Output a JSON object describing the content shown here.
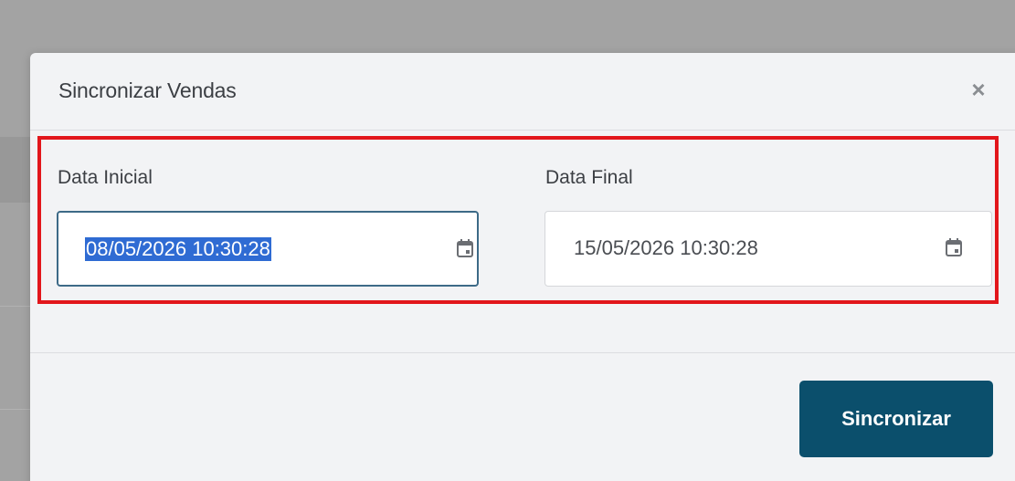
{
  "modal": {
    "title": "Sincronizar Vendas",
    "close_symbol": "×",
    "close_icon": "close-icon"
  },
  "form": {
    "start": {
      "label": "Data Inicial",
      "value": "08/05/2026 10:30:28",
      "icon": "calendar-icon",
      "state": "focused, text selected"
    },
    "end": {
      "label": "Data Final",
      "value": "15/05/2026 10:30:28",
      "icon": "calendar-icon"
    }
  },
  "footer": {
    "submit_label": "Sincronizar"
  },
  "colors": {
    "highlight_border": "#e2161b",
    "primary_button": "#0b4f6c",
    "selection": "#2f6bd3",
    "focus_border": "#3d6a87"
  }
}
